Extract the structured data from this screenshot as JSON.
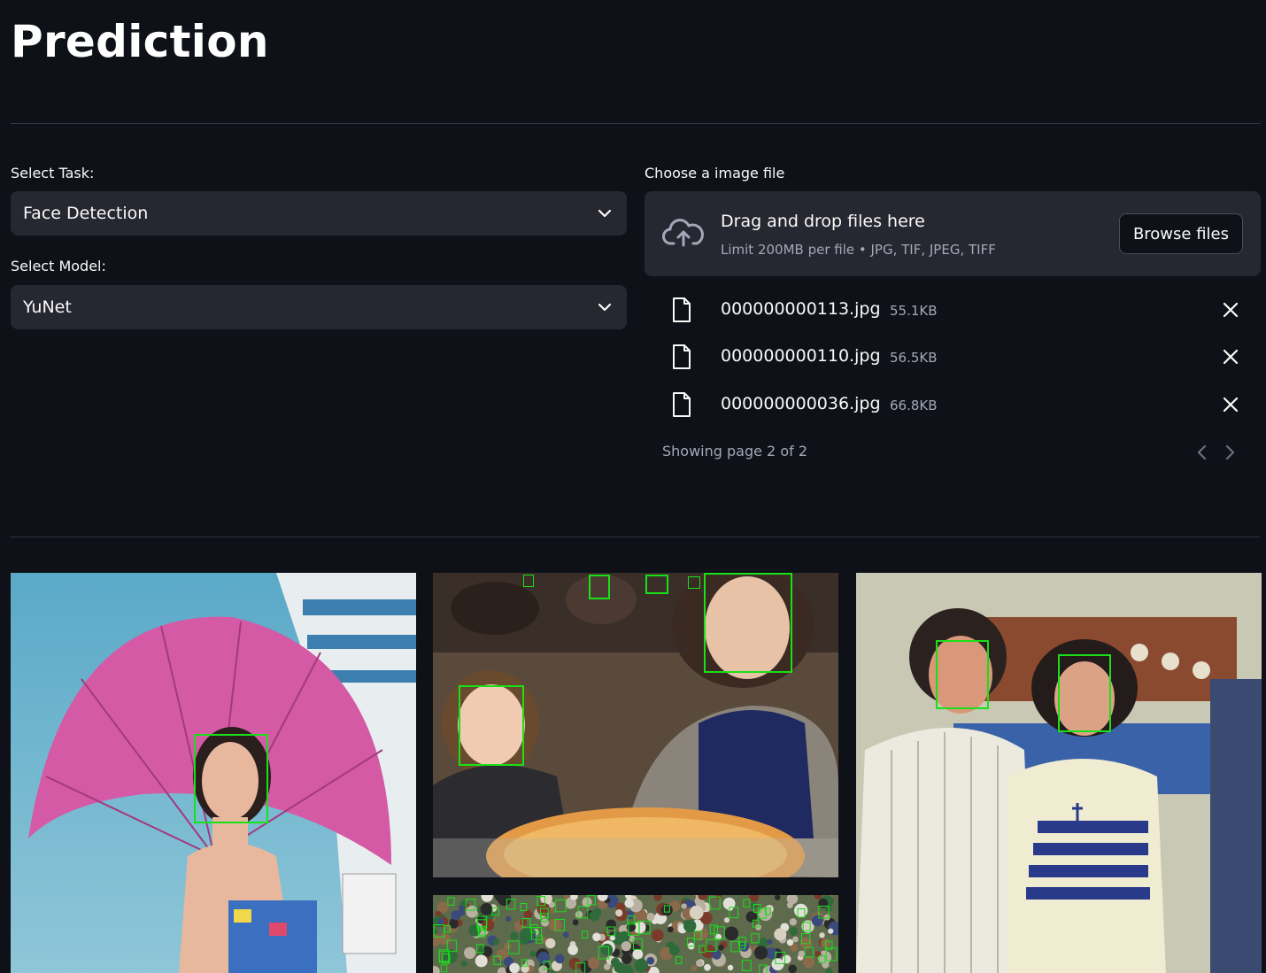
{
  "page": {
    "title": "Prediction"
  },
  "task": {
    "label": "Select Task:",
    "value": "Face Detection"
  },
  "model": {
    "label": "Select Model:",
    "value": "YuNet"
  },
  "uploader": {
    "label": "Choose a image file",
    "drop_text": "Drag and drop files here",
    "limit_text": "Limit 200MB per file • JPG, TIF, JPEG, TIFF",
    "browse_label": "Browse files",
    "files": [
      {
        "name": "000000000113.jpg",
        "size": "55.1KB"
      },
      {
        "name": "000000000110.jpg",
        "size": "56.5KB"
      },
      {
        "name": "000000000036.jpg",
        "size": "66.8KB"
      }
    ],
    "pagination": "Showing page 2 of 2"
  },
  "results": {
    "images": [
      {
        "name": "umbrella-woman"
      },
      {
        "name": "pizza-family"
      },
      {
        "name": "couple-kitchen"
      },
      {
        "name": "crowd"
      }
    ],
    "box_color": "#19e019"
  }
}
